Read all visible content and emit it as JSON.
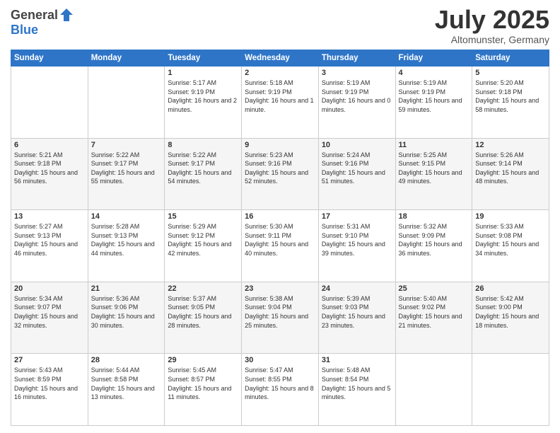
{
  "header": {
    "logo_line1": "General",
    "logo_line2": "Blue",
    "month": "July 2025",
    "location": "Altomunster, Germany"
  },
  "weekdays": [
    "Sunday",
    "Monday",
    "Tuesday",
    "Wednesday",
    "Thursday",
    "Friday",
    "Saturday"
  ],
  "weeks": [
    [
      {
        "day": "",
        "sunrise": "",
        "sunset": "",
        "daylight": ""
      },
      {
        "day": "",
        "sunrise": "",
        "sunset": "",
        "daylight": ""
      },
      {
        "day": "1",
        "sunrise": "Sunrise: 5:17 AM",
        "sunset": "Sunset: 9:19 PM",
        "daylight": "Daylight: 16 hours and 2 minutes."
      },
      {
        "day": "2",
        "sunrise": "Sunrise: 5:18 AM",
        "sunset": "Sunset: 9:19 PM",
        "daylight": "Daylight: 16 hours and 1 minute."
      },
      {
        "day": "3",
        "sunrise": "Sunrise: 5:19 AM",
        "sunset": "Sunset: 9:19 PM",
        "daylight": "Daylight: 16 hours and 0 minutes."
      },
      {
        "day": "4",
        "sunrise": "Sunrise: 5:19 AM",
        "sunset": "Sunset: 9:19 PM",
        "daylight": "Daylight: 15 hours and 59 minutes."
      },
      {
        "day": "5",
        "sunrise": "Sunrise: 5:20 AM",
        "sunset": "Sunset: 9:18 PM",
        "daylight": "Daylight: 15 hours and 58 minutes."
      }
    ],
    [
      {
        "day": "6",
        "sunrise": "Sunrise: 5:21 AM",
        "sunset": "Sunset: 9:18 PM",
        "daylight": "Daylight: 15 hours and 56 minutes."
      },
      {
        "day": "7",
        "sunrise": "Sunrise: 5:22 AM",
        "sunset": "Sunset: 9:17 PM",
        "daylight": "Daylight: 15 hours and 55 minutes."
      },
      {
        "day": "8",
        "sunrise": "Sunrise: 5:22 AM",
        "sunset": "Sunset: 9:17 PM",
        "daylight": "Daylight: 15 hours and 54 minutes."
      },
      {
        "day": "9",
        "sunrise": "Sunrise: 5:23 AM",
        "sunset": "Sunset: 9:16 PM",
        "daylight": "Daylight: 15 hours and 52 minutes."
      },
      {
        "day": "10",
        "sunrise": "Sunrise: 5:24 AM",
        "sunset": "Sunset: 9:16 PM",
        "daylight": "Daylight: 15 hours and 51 minutes."
      },
      {
        "day": "11",
        "sunrise": "Sunrise: 5:25 AM",
        "sunset": "Sunset: 9:15 PM",
        "daylight": "Daylight: 15 hours and 49 minutes."
      },
      {
        "day": "12",
        "sunrise": "Sunrise: 5:26 AM",
        "sunset": "Sunset: 9:14 PM",
        "daylight": "Daylight: 15 hours and 48 minutes."
      }
    ],
    [
      {
        "day": "13",
        "sunrise": "Sunrise: 5:27 AM",
        "sunset": "Sunset: 9:13 PM",
        "daylight": "Daylight: 15 hours and 46 minutes."
      },
      {
        "day": "14",
        "sunrise": "Sunrise: 5:28 AM",
        "sunset": "Sunset: 9:13 PM",
        "daylight": "Daylight: 15 hours and 44 minutes."
      },
      {
        "day": "15",
        "sunrise": "Sunrise: 5:29 AM",
        "sunset": "Sunset: 9:12 PM",
        "daylight": "Daylight: 15 hours and 42 minutes."
      },
      {
        "day": "16",
        "sunrise": "Sunrise: 5:30 AM",
        "sunset": "Sunset: 9:11 PM",
        "daylight": "Daylight: 15 hours and 40 minutes."
      },
      {
        "day": "17",
        "sunrise": "Sunrise: 5:31 AM",
        "sunset": "Sunset: 9:10 PM",
        "daylight": "Daylight: 15 hours and 39 minutes."
      },
      {
        "day": "18",
        "sunrise": "Sunrise: 5:32 AM",
        "sunset": "Sunset: 9:09 PM",
        "daylight": "Daylight: 15 hours and 36 minutes."
      },
      {
        "day": "19",
        "sunrise": "Sunrise: 5:33 AM",
        "sunset": "Sunset: 9:08 PM",
        "daylight": "Daylight: 15 hours and 34 minutes."
      }
    ],
    [
      {
        "day": "20",
        "sunrise": "Sunrise: 5:34 AM",
        "sunset": "Sunset: 9:07 PM",
        "daylight": "Daylight: 15 hours and 32 minutes."
      },
      {
        "day": "21",
        "sunrise": "Sunrise: 5:36 AM",
        "sunset": "Sunset: 9:06 PM",
        "daylight": "Daylight: 15 hours and 30 minutes."
      },
      {
        "day": "22",
        "sunrise": "Sunrise: 5:37 AM",
        "sunset": "Sunset: 9:05 PM",
        "daylight": "Daylight: 15 hours and 28 minutes."
      },
      {
        "day": "23",
        "sunrise": "Sunrise: 5:38 AM",
        "sunset": "Sunset: 9:04 PM",
        "daylight": "Daylight: 15 hours and 25 minutes."
      },
      {
        "day": "24",
        "sunrise": "Sunrise: 5:39 AM",
        "sunset": "Sunset: 9:03 PM",
        "daylight": "Daylight: 15 hours and 23 minutes."
      },
      {
        "day": "25",
        "sunrise": "Sunrise: 5:40 AM",
        "sunset": "Sunset: 9:02 PM",
        "daylight": "Daylight: 15 hours and 21 minutes."
      },
      {
        "day": "26",
        "sunrise": "Sunrise: 5:42 AM",
        "sunset": "Sunset: 9:00 PM",
        "daylight": "Daylight: 15 hours and 18 minutes."
      }
    ],
    [
      {
        "day": "27",
        "sunrise": "Sunrise: 5:43 AM",
        "sunset": "Sunset: 8:59 PM",
        "daylight": "Daylight: 15 hours and 16 minutes."
      },
      {
        "day": "28",
        "sunrise": "Sunrise: 5:44 AM",
        "sunset": "Sunset: 8:58 PM",
        "daylight": "Daylight: 15 hours and 13 minutes."
      },
      {
        "day": "29",
        "sunrise": "Sunrise: 5:45 AM",
        "sunset": "Sunset: 8:57 PM",
        "daylight": "Daylight: 15 hours and 11 minutes."
      },
      {
        "day": "30",
        "sunrise": "Sunrise: 5:47 AM",
        "sunset": "Sunset: 8:55 PM",
        "daylight": "Daylight: 15 hours and 8 minutes."
      },
      {
        "day": "31",
        "sunrise": "Sunrise: 5:48 AM",
        "sunset": "Sunset: 8:54 PM",
        "daylight": "Daylight: 15 hours and 5 minutes."
      },
      {
        "day": "",
        "sunrise": "",
        "sunset": "",
        "daylight": ""
      },
      {
        "day": "",
        "sunrise": "",
        "sunset": "",
        "daylight": ""
      }
    ]
  ]
}
